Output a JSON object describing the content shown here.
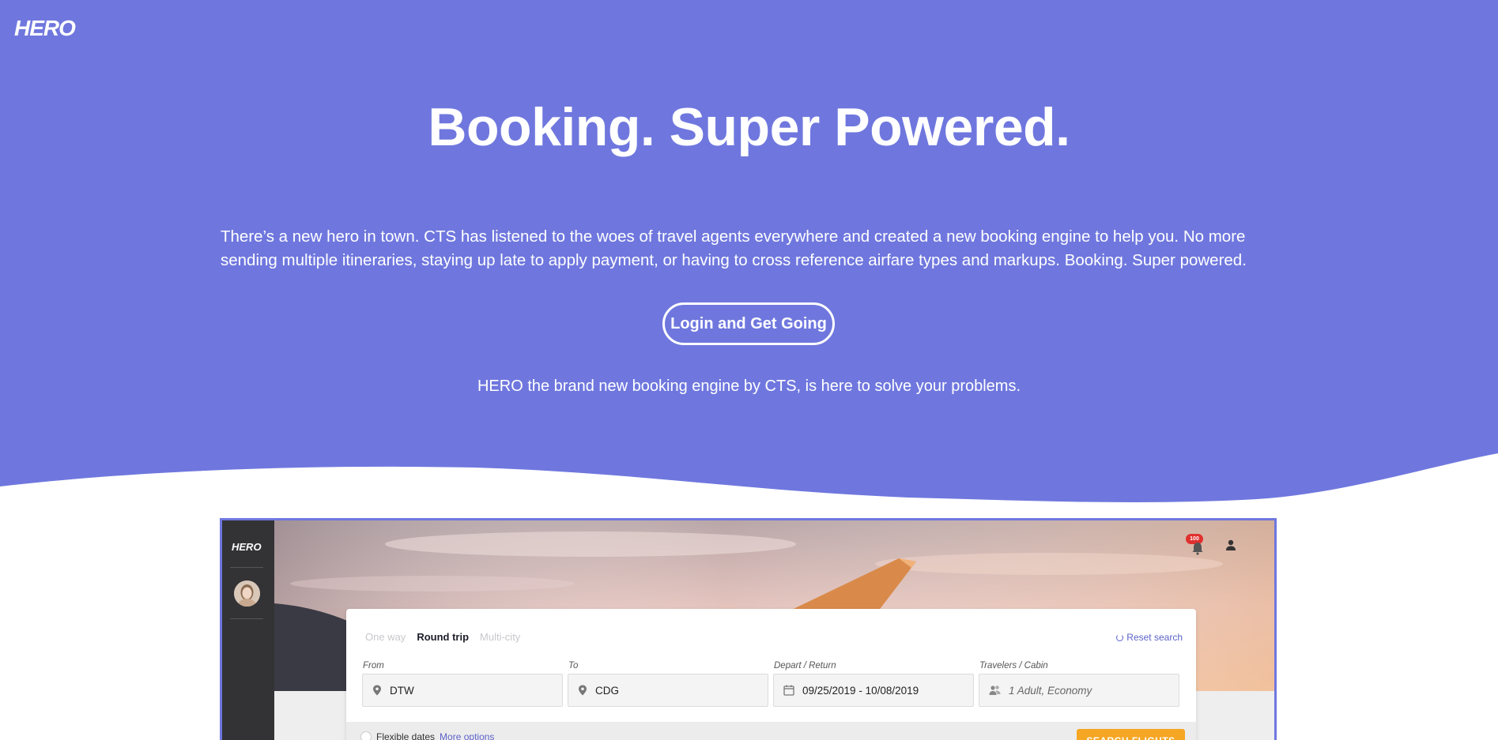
{
  "brand": {
    "logo_text": "HERO",
    "accent": "#6f77de",
    "cta_color": "#f5a623"
  },
  "hero": {
    "headline": "Booking. Super Powered.",
    "intro": "There’s a new hero in town. CTS has listened to the woes of travel agents everywhere and created a new booking engine to help you. No more sending multiple itineraries, staying up late to apply payment, or having to cross reference airfare types and markups. Booking. Super powered.",
    "cta_label": "Login and Get Going",
    "tagline": "HERO the brand new booking engine by CTS, is here to solve your problems."
  },
  "preview": {
    "sidebar": {
      "logo_text": "HERO"
    },
    "topbar": {
      "notification_count": "100"
    },
    "search": {
      "trip_types": [
        {
          "label": "One way",
          "active": false
        },
        {
          "label": "Round trip",
          "active": true
        },
        {
          "label": "Multi-city",
          "active": false
        }
      ],
      "reset_label": "Reset search",
      "from": {
        "label": "From",
        "value": "DTW"
      },
      "to": {
        "label": "To",
        "value": "CDG"
      },
      "dates": {
        "label": "Depart / Return",
        "value": "09/25/2019 - 10/08/2019"
      },
      "travelers": {
        "label": "Travelers / Cabin",
        "placeholder": "1 Adult, Economy"
      },
      "flexible_label": "Flexible dates",
      "more_options_label": "More options",
      "search_button": "SEARCH FLIGHTS"
    }
  }
}
